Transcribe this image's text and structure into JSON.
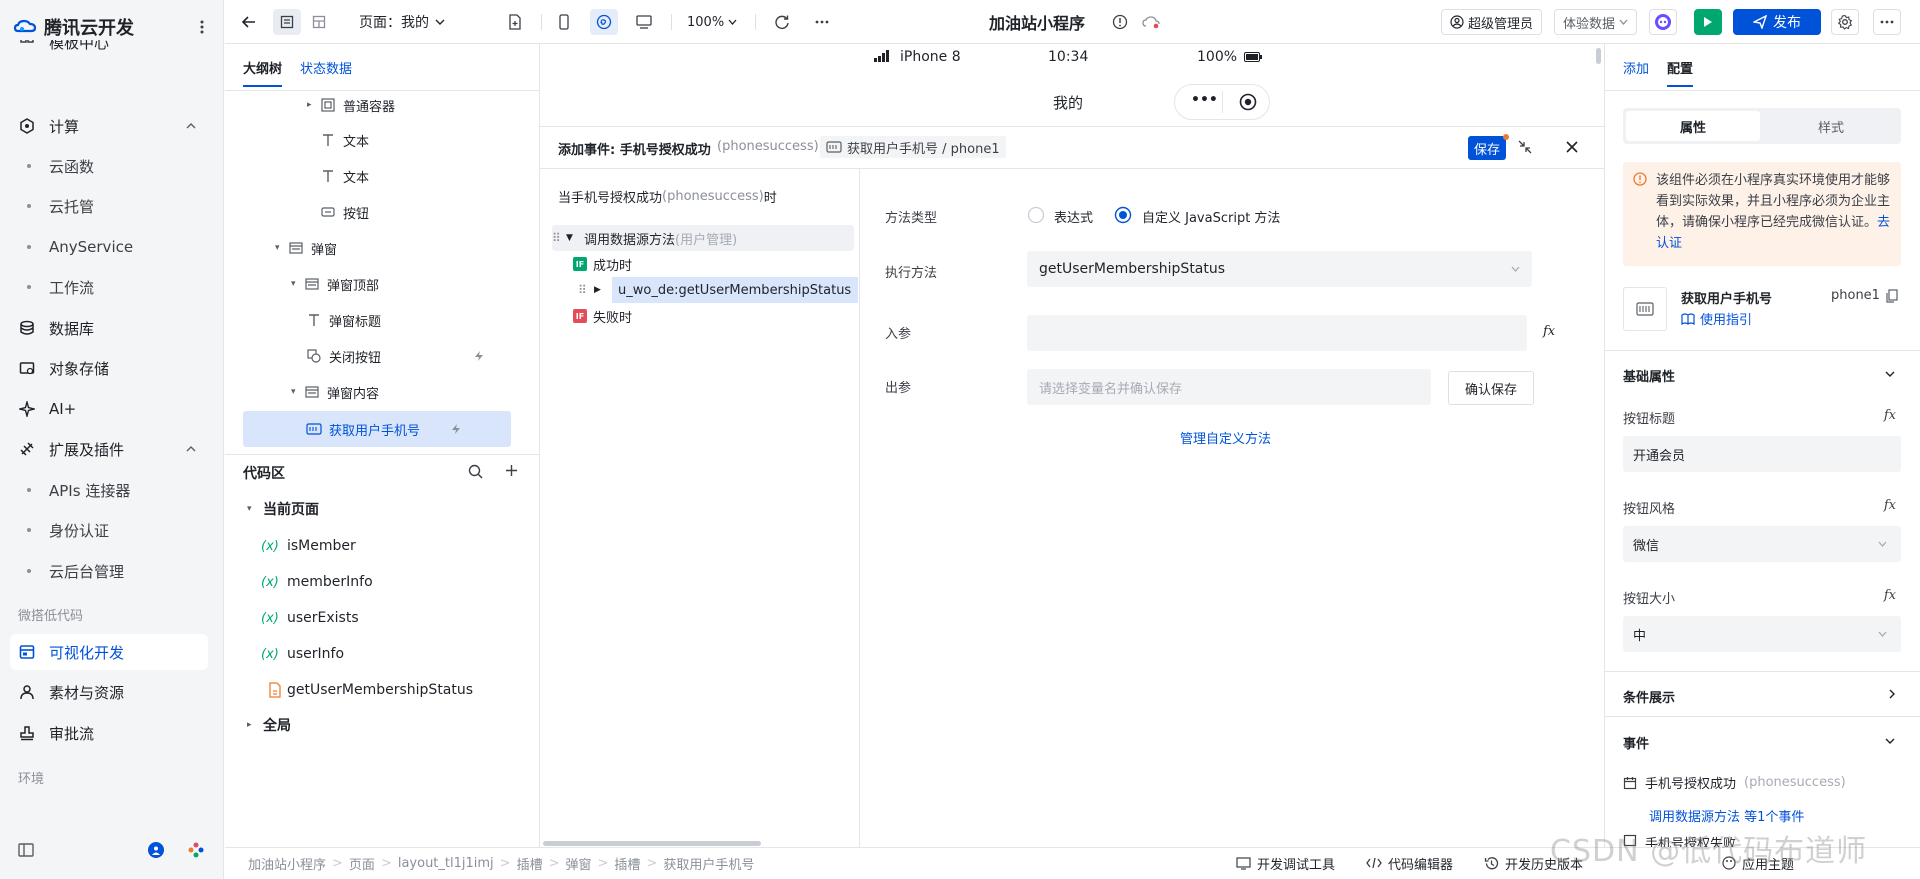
{
  "app": {
    "brand": "腾讯云开发",
    "brand_color": "#0052d9"
  },
  "leftnav": {
    "partial_top": "模板中心",
    "compute_group": "计算",
    "compute_items": [
      "云函数",
      "云托管",
      "AnyService",
      "工作流"
    ],
    "database": "数据库",
    "storage": "对象存储",
    "ai": "AI+",
    "ext_group": "扩展及插件",
    "ext_items": [
      "APIs 连接器",
      "身份认证",
      "云后台管理"
    ],
    "lowcode_group": "微搭低代码",
    "visual_dev": "可视化开发",
    "materials": "素材与资源",
    "approval": "审批流",
    "env_group": "环境"
  },
  "toolbar": {
    "page_select": "页面：我的",
    "zoom": "100%",
    "app_title": "加油站小程序",
    "role": "超级管理员",
    "data_mode": "体验数据",
    "publish": "发布"
  },
  "outline": {
    "tabs": [
      "大纲树",
      "状态数据"
    ],
    "rows": [
      {
        "label": "普通容器",
        "icon": "container-icon"
      },
      {
        "label": "文本",
        "icon": "text-icon"
      },
      {
        "label": "文本",
        "icon": "text-icon"
      },
      {
        "label": "按钮",
        "icon": "button-icon"
      },
      {
        "label": "弹窗",
        "icon": "modal-icon"
      },
      {
        "label": "弹窗顶部",
        "icon": "modal-icon"
      },
      {
        "label": "弹窗标题",
        "icon": "text-icon"
      },
      {
        "label": "关闭按钮",
        "icon": "copy-icon"
      },
      {
        "label": "弹窗内容",
        "icon": "modal-icon"
      },
      {
        "label": "获取用户手机号",
        "icon": "phone-button-icon"
      }
    ]
  },
  "codearea": {
    "title": "代码区",
    "current_page": "当前页面",
    "vars": [
      "isMember",
      "memberInfo",
      "userExists",
      "userInfo"
    ],
    "method": "getUserMembershipStatus",
    "global": "全局",
    "var_symbol": "(x)"
  },
  "phone": {
    "device": "iPhone 8",
    "time": "10:34",
    "battery": "100%",
    "page_title": "我的",
    "capsule_dots": "•••"
  },
  "event": {
    "header_prefix": "添加事件: 手机号授权成功",
    "header_event_id": "(phonesuccess)",
    "header_component": "获取用户手机号 / phone1",
    "save": "保存",
    "trigger_prefix": "当手机号授权成功",
    "trigger_event_id": "(phonesuccess)",
    "trigger_suffix": "时",
    "action": "调用数据源方法",
    "action_source": "(用户管理)",
    "on_success": "成功时",
    "success_action": "u_wo_de:getUserMembershipStatus",
    "on_fail": "失败时",
    "if_tag": "IF",
    "method_type_label": "方法类型",
    "radio_expr": "表达式",
    "radio_custom": "自定义 JavaScript 方法",
    "exec_label": "执行方法",
    "exec_value": "getUserMembershipStatus",
    "in_label": "入参",
    "out_label": "出参",
    "out_placeholder": "请选择变量名并确认保存",
    "confirm_save": "确认保存",
    "manage_link": "管理自定义方法",
    "fx": "fx"
  },
  "rightpanel": {
    "tabs": [
      "添加",
      "配置"
    ],
    "seg": [
      "属性",
      "样式"
    ],
    "notice": "该组件必须在小程序真实环境使用才能够看到实际效果，并且小程序必须为企业主体，请确保小程序已经完成微信认证。",
    "notice_link": "去认证",
    "component_name": "获取用户手机号",
    "component_id": "phone1",
    "guide_link": "使用指引",
    "basic_section": "基础属性",
    "btn_title_label": "按钮标题",
    "btn_title_value": "开通会员",
    "btn_style_label": "按钮风格",
    "btn_style_value": "微信",
    "btn_size_label": "按钮大小",
    "btn_size_value": "中",
    "cond_section": "条件展示",
    "events_section": "事件",
    "event_name": "手机号授权成功",
    "event_id": "(phonesuccess)",
    "event_summary": "调用数据源方法 等1个事件",
    "event_partial": "手机号授权失败"
  },
  "bottombar": {
    "breadcrumbs": [
      "加油站小程序",
      "页面",
      "layout_tl1j1imj",
      "插槽",
      "弹窗",
      "插槽",
      "获取用户手机号"
    ],
    "devtools": "开发调试工具",
    "code_editor": "代码编辑器",
    "history": "开发历史版本",
    "theme": "应用主题"
  },
  "watermark": "CSDN @低代码布道师"
}
